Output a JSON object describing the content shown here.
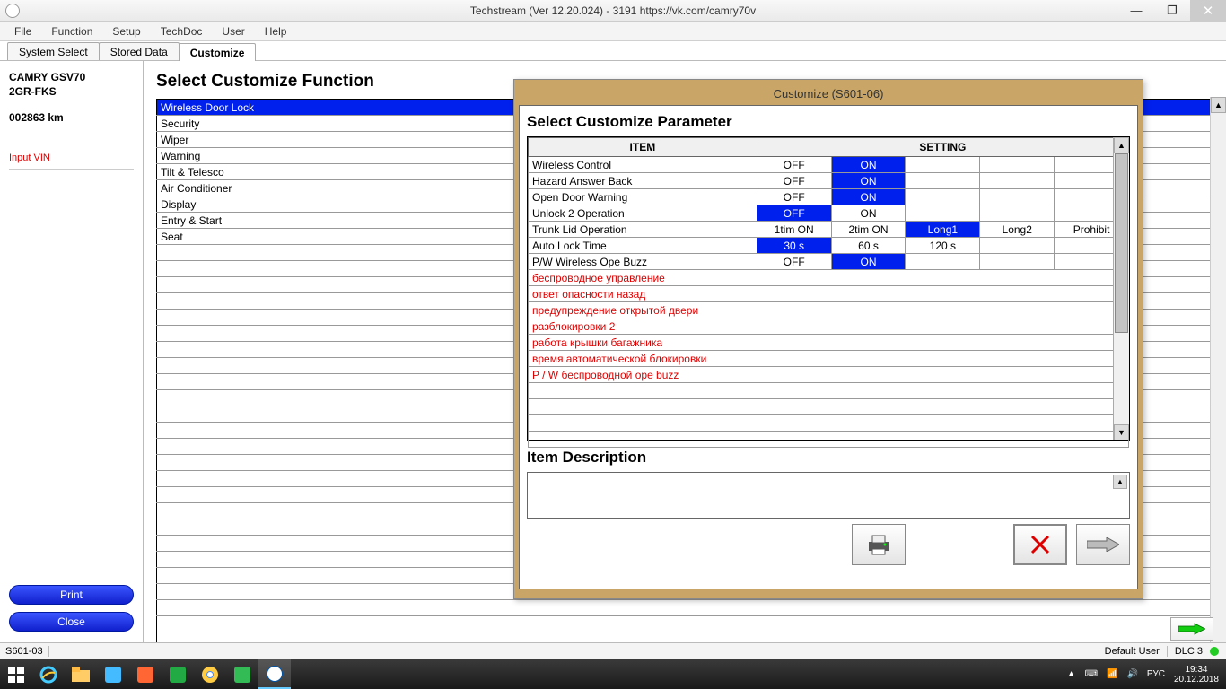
{
  "titlebar": {
    "title": "Techstream (Ver 12.20.024) - 3191  https://vk.com/camry70v"
  },
  "menus": [
    "File",
    "Function",
    "Setup",
    "TechDoc",
    "User",
    "Help"
  ],
  "subtabs": {
    "items": [
      "System Select",
      "Stored Data",
      "Customize"
    ],
    "active": 2
  },
  "sidebar": {
    "vehicle": "CAMRY GSV70",
    "engine": "2GR-FKS",
    "odometer": "002863 km",
    "inputvin": "Input VIN",
    "printLabel": "Print",
    "closeLabel": "Close"
  },
  "content": {
    "heading": "Select Customize Function",
    "functions": [
      "Wireless Door Lock",
      "Security",
      "Wiper",
      "Warning",
      "Tilt & Telesco",
      "Air Conditioner",
      "Display",
      "Entry & Start",
      "Seat"
    ],
    "selectedIndex": 0,
    "emptyRows": 25
  },
  "dialog": {
    "title": "Customize (S601-06)",
    "heading": "Select Customize Parameter",
    "th_item": "ITEM",
    "th_setting": "SETTING",
    "rows": [
      {
        "item": "Wireless Control",
        "opts": [
          "OFF",
          "ON",
          "",
          "",
          ""
        ],
        "sel": 1
      },
      {
        "item": "Hazard Answer Back",
        "opts": [
          "OFF",
          "ON",
          "",
          "",
          ""
        ],
        "sel": 1
      },
      {
        "item": "Open Door Warning",
        "opts": [
          "OFF",
          "ON",
          "",
          "",
          ""
        ],
        "sel": 1
      },
      {
        "item": "Unlock 2 Operation",
        "opts": [
          "OFF",
          "ON",
          "",
          "",
          ""
        ],
        "sel": 0
      },
      {
        "item": "Trunk Lid Operation",
        "opts": [
          "1tim ON",
          "2tim ON",
          "Long1",
          "Long2",
          "Prohibit"
        ],
        "sel": 2
      },
      {
        "item": "Auto Lock Time",
        "opts": [
          "30 s",
          "60 s",
          "120 s",
          "",
          ""
        ],
        "sel": 0
      },
      {
        "item": "P/W Wireless Ope Buzz",
        "opts": [
          "OFF",
          "ON",
          "",
          "",
          ""
        ],
        "sel": 1
      }
    ],
    "translations": [
      "беспроводное управление",
      "ответ опасности назад",
      "предупреждение открытой двери",
      "разблокировки 2",
      "работа крышки багажника",
      "время автоматической блокировки",
      "P / W беспроводной ope buzz"
    ],
    "emptyRows": 4,
    "descHeading": "Item Description"
  },
  "statusbar": {
    "left": "S601-03",
    "user": "Default User",
    "dlc": "DLC 3"
  },
  "tray": {
    "lang": "РУС",
    "time": "19:34",
    "date": "20.12.2018"
  }
}
